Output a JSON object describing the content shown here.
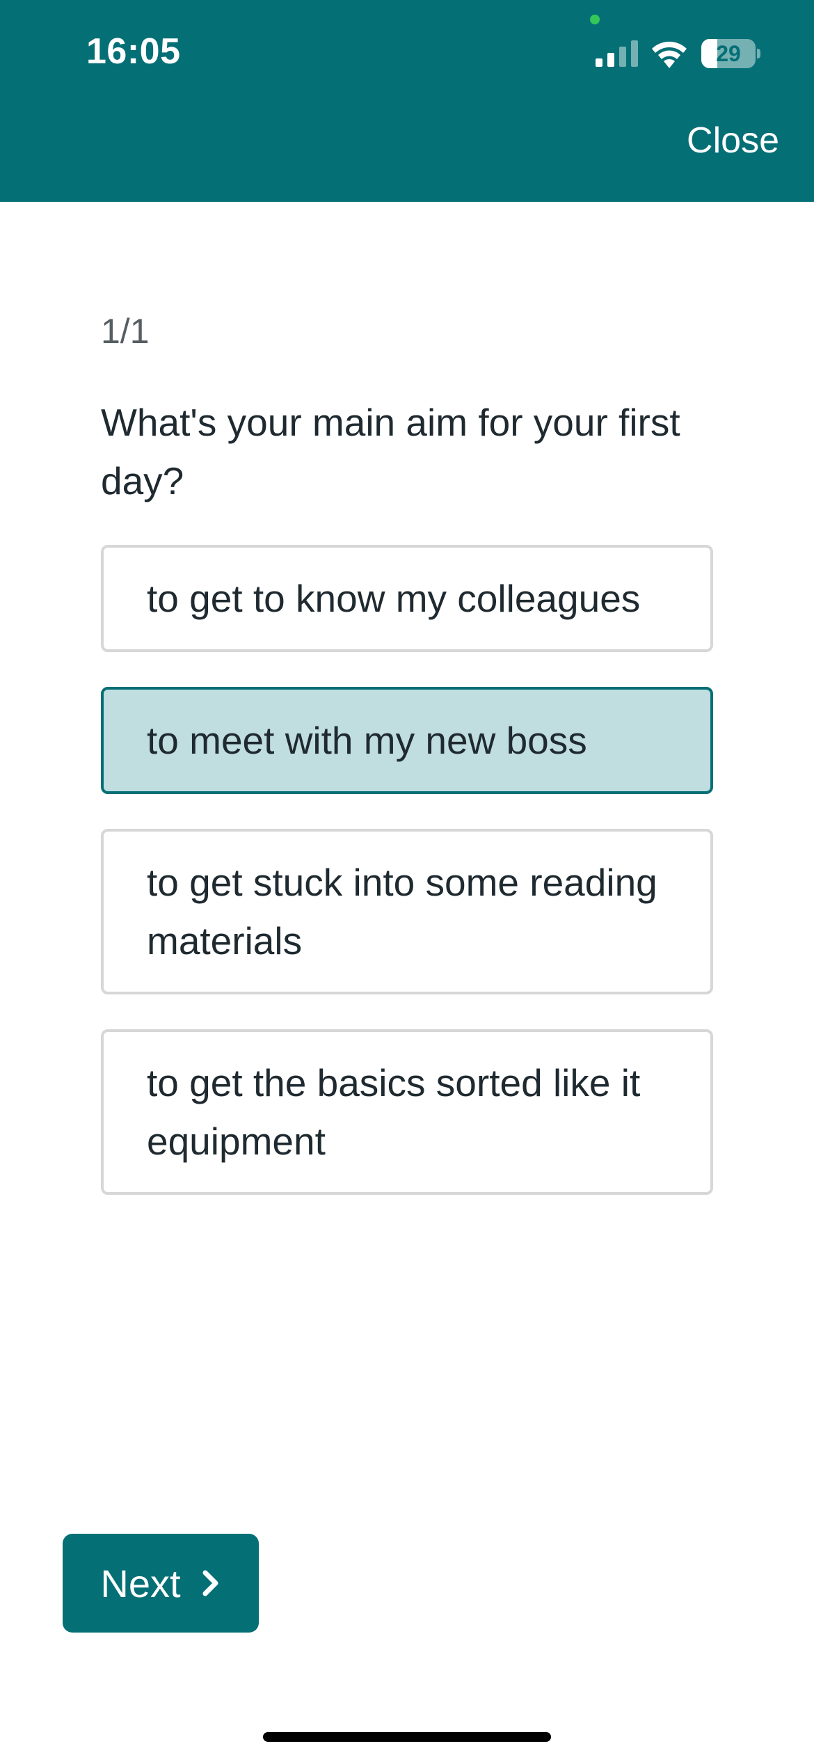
{
  "status_bar": {
    "time": "16:05",
    "battery": "29",
    "battery_level": 0.29
  },
  "header": {
    "close_label": "Close"
  },
  "quiz": {
    "progress": "1/1",
    "question": "What's your main aim for your first day?",
    "selected_index": 1,
    "options": [
      {
        "label": "to get to know my colleagues"
      },
      {
        "label": "to meet with my new boss"
      },
      {
        "label": "to get stuck into some reading materials"
      },
      {
        "label": "to get the basics sorted like it equipment"
      }
    ]
  },
  "footer": {
    "next_label": "Next"
  },
  "colors": {
    "brand": "#056f76",
    "selected_fill": "#c0dde0",
    "option_border": "#d7d7d7"
  },
  "icons": {
    "signal": "signal-icon",
    "wifi": "wifi-icon",
    "battery": "battery-icon",
    "next": "chevron-right-icon"
  }
}
